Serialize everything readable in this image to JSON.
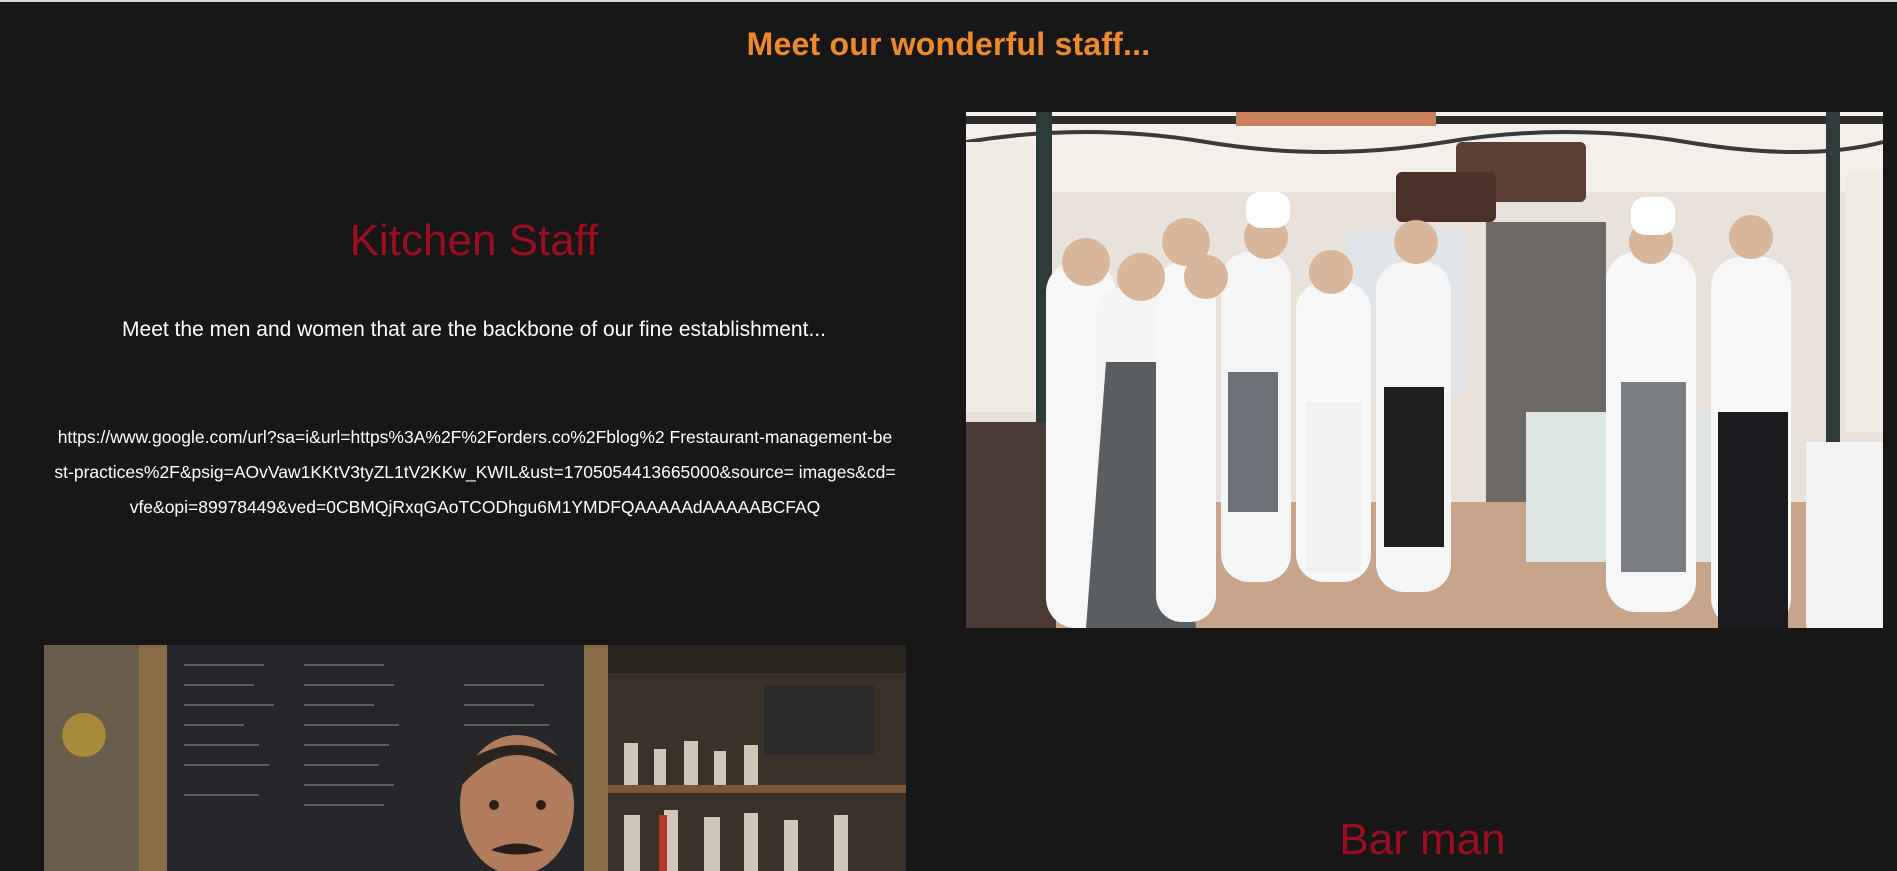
{
  "page": {
    "title": "Meet our wonderful staff...",
    "accent_color": "#f0892b",
    "heading_color": "#9b0d21",
    "background_color": "#171717"
  },
  "kitchen": {
    "heading": "Kitchen Staff",
    "description": "Meet the men and women that are the backbone of our fine establishment...",
    "url_lines": [
      "https://www.google.com/url?sa=i&url=https%3A%2F%2Forders.co%2Fblog%2 Frestaurant-management-be",
      "st-practices%2F&psig=AOvVaw1KKtV3tyZL1tV2KKw_KWIL&ust=1705054413665000&source= images&cd=",
      "vfe&opi=89978449&ved=0CBMQjRxqGAoTCODhgu6M1YMDFQAAAAAdAAAAABCFAQ"
    ],
    "photo_icon": "kitchen-staff-photo"
  },
  "bar": {
    "heading": "Bar man",
    "photo_icon": "bartender-photo"
  }
}
